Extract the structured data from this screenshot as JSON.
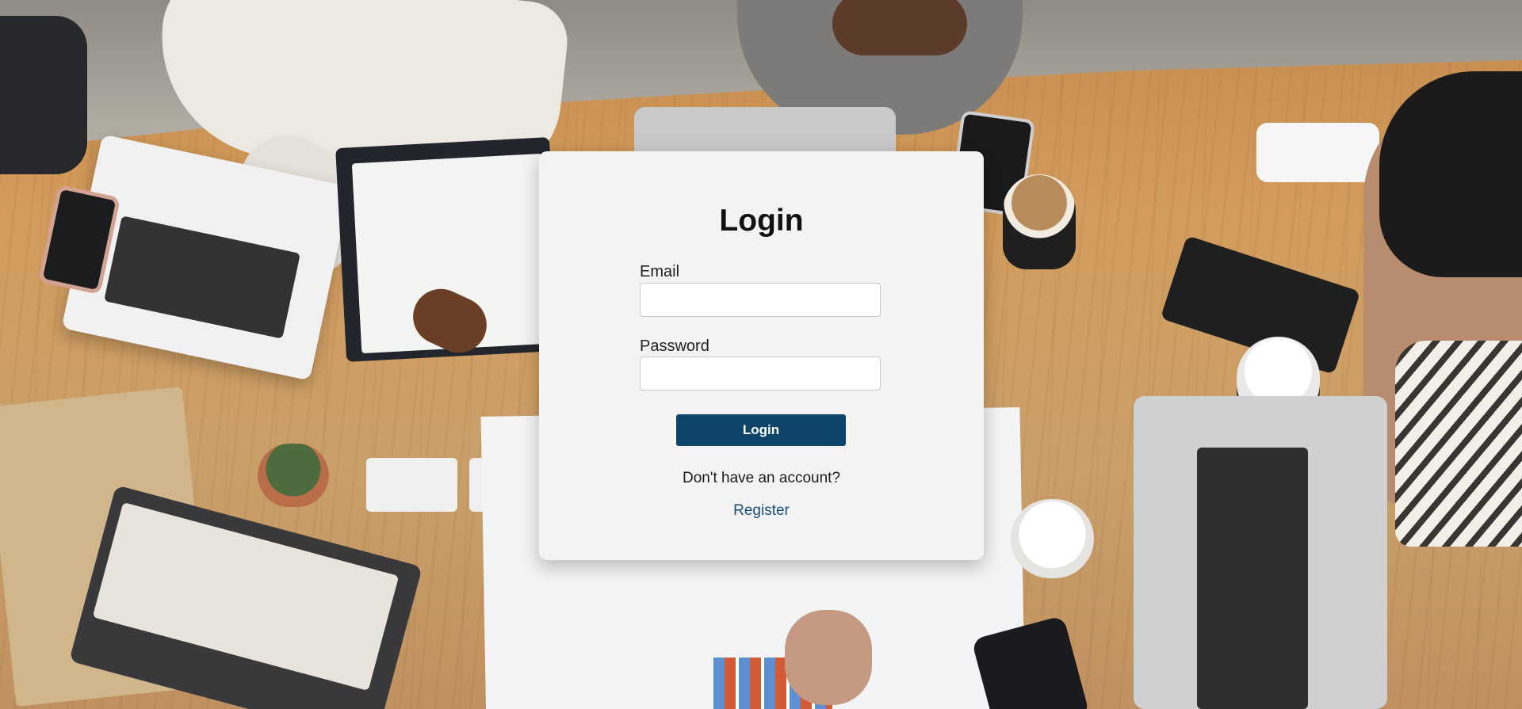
{
  "login_card": {
    "title": "Login",
    "email_label": "Email",
    "email_value": "",
    "password_label": "Password",
    "password_value": "",
    "submit_label": "Login",
    "account_prompt": "Don't have an account?",
    "register_link": "Register"
  },
  "colors": {
    "primary_button": "#10456b",
    "link": "#1a4f78",
    "card_background": "#f3f3f3"
  }
}
